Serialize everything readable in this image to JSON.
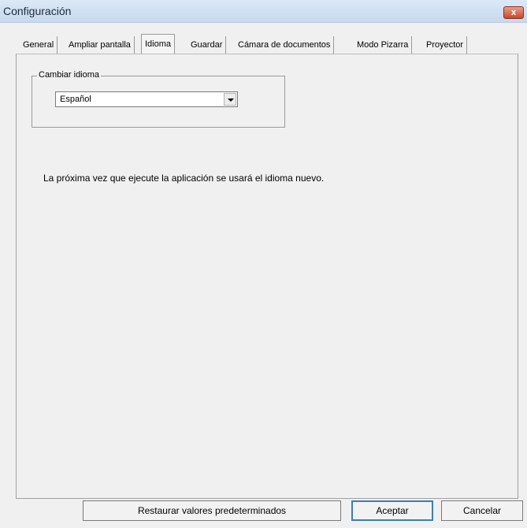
{
  "window": {
    "title": "Configuración",
    "close_label": "x"
  },
  "tabs": [
    {
      "label": "General"
    },
    {
      "label": "Ampliar pantalla"
    },
    {
      "label": "Idioma",
      "active": true
    },
    {
      "label": "Guardar"
    },
    {
      "label": "Cámara de documentos"
    },
    {
      "label": "Modo Pizarra"
    },
    {
      "label": "Proyector"
    }
  ],
  "language_group": {
    "legend": "Cambiar idioma",
    "selected": "Español",
    "dropdown_icon": "chevron-down-icon"
  },
  "info_text": "La próxima vez que ejecute la aplicación se usará el idioma nuevo.",
  "buttons": {
    "restore": "Restaurar valores predeterminados",
    "accept": "Aceptar",
    "cancel": "Cancelar"
  },
  "colors": {
    "titlebar": "#c7d9ee",
    "close_button": "#c9462c",
    "default_button_border": "#3c7fb1"
  }
}
